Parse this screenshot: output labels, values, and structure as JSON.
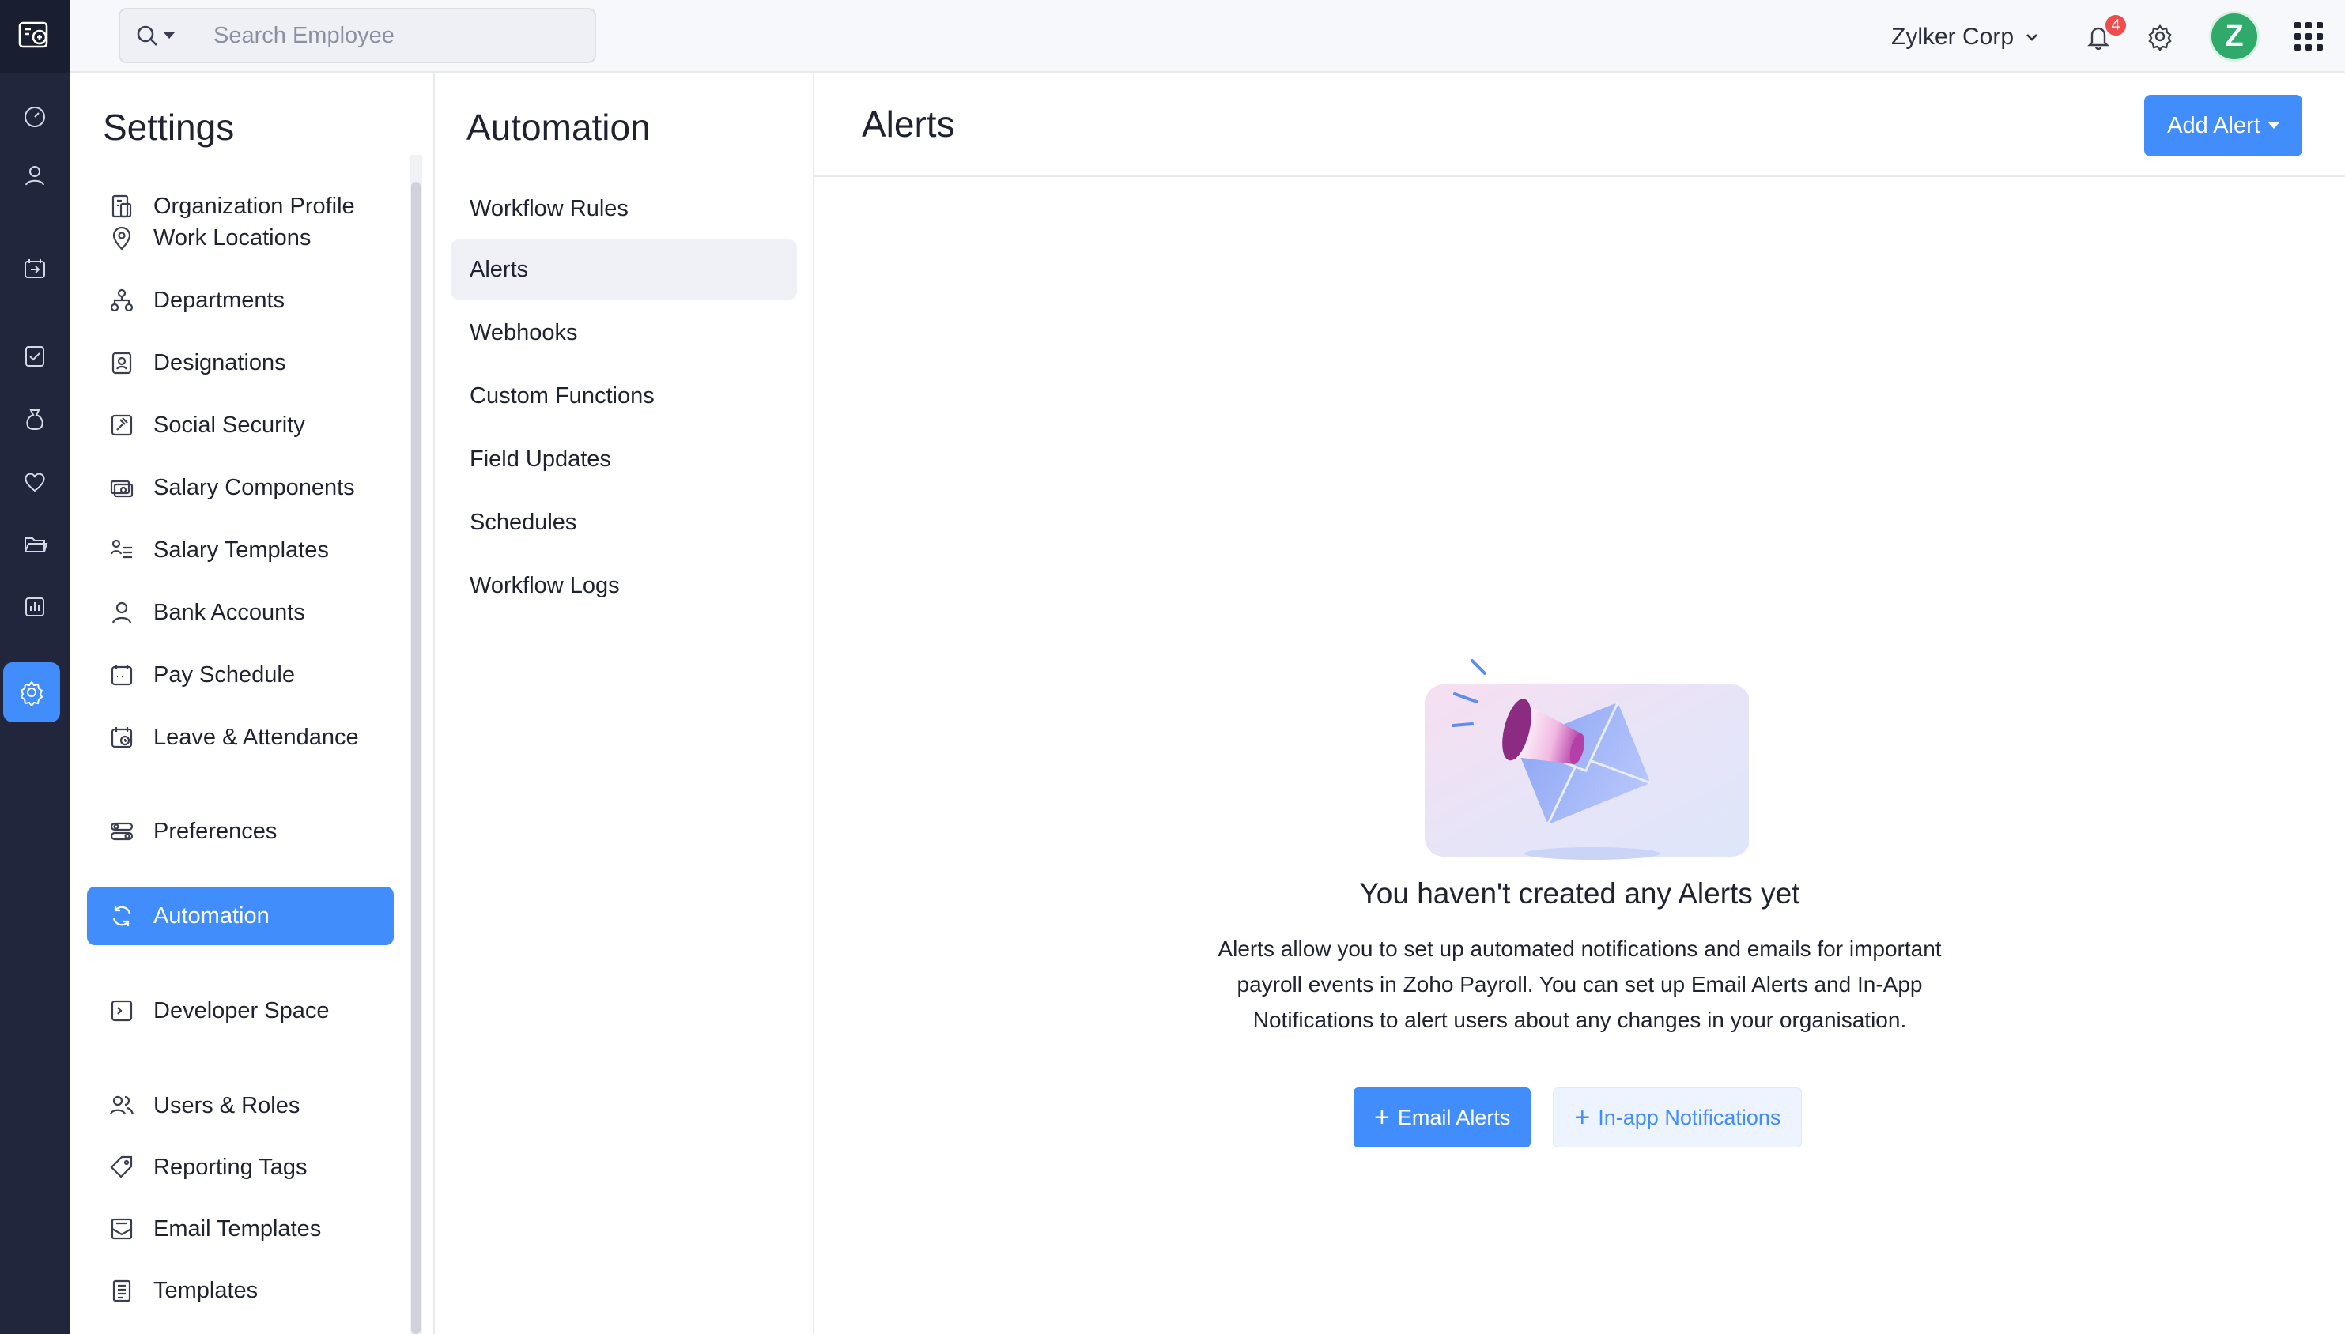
{
  "search": {
    "placeholder": "Search Employee"
  },
  "topbar": {
    "org_name": "Zylker Corp",
    "notification_count": "4",
    "avatar_letter": "Z"
  },
  "rail": {
    "icons": [
      "dashboard-icon",
      "employees-icon",
      "pay-runs-icon",
      "approvals-icon",
      "loans-icon",
      "benefits-icon",
      "documents-icon",
      "reports-icon",
      "settings-icon"
    ]
  },
  "settings": {
    "title": "Settings",
    "items": [
      {
        "label": "Organization Profile"
      },
      {
        "label": "Work Locations"
      },
      {
        "label": "Departments"
      },
      {
        "label": "Designations"
      },
      {
        "label": "Social Security"
      },
      {
        "label": "Salary Components"
      },
      {
        "label": "Salary Templates"
      },
      {
        "label": "Bank Accounts"
      },
      {
        "label": "Pay Schedule"
      },
      {
        "label": "Leave & Attendance"
      },
      {
        "label": "Preferences"
      },
      {
        "label": "Automation"
      },
      {
        "label": "Developer Space"
      },
      {
        "label": "Users & Roles"
      },
      {
        "label": "Reporting Tags"
      },
      {
        "label": "Email Templates"
      },
      {
        "label": "Templates"
      }
    ]
  },
  "automation": {
    "title": "Automation",
    "items": [
      {
        "label": "Workflow Rules"
      },
      {
        "label": "Alerts"
      },
      {
        "label": "Webhooks"
      },
      {
        "label": "Custom Functions"
      },
      {
        "label": "Field Updates"
      },
      {
        "label": "Schedules"
      },
      {
        "label": "Workflow Logs"
      }
    ]
  },
  "main": {
    "title": "Alerts",
    "add_button": "Add Alert",
    "empty_title": "You haven't created any Alerts yet",
    "empty_desc_lines": [
      "Alerts allow you to set up automated notifications and emails for important",
      "payroll events in Zoho Payroll. You can set up Email Alerts and In-App",
      "Notifications to alert users about any changes in your organisation."
    ],
    "email_alerts_button": "Email Alerts",
    "inapp_button": "In-app Notifications"
  },
  "colors": {
    "accent": "#408dfb",
    "rail_bg": "#21263c",
    "active_submenu_bg": "#eff1f7",
    "badge": "#ef4d4d",
    "avatar": "#2faa6a"
  }
}
